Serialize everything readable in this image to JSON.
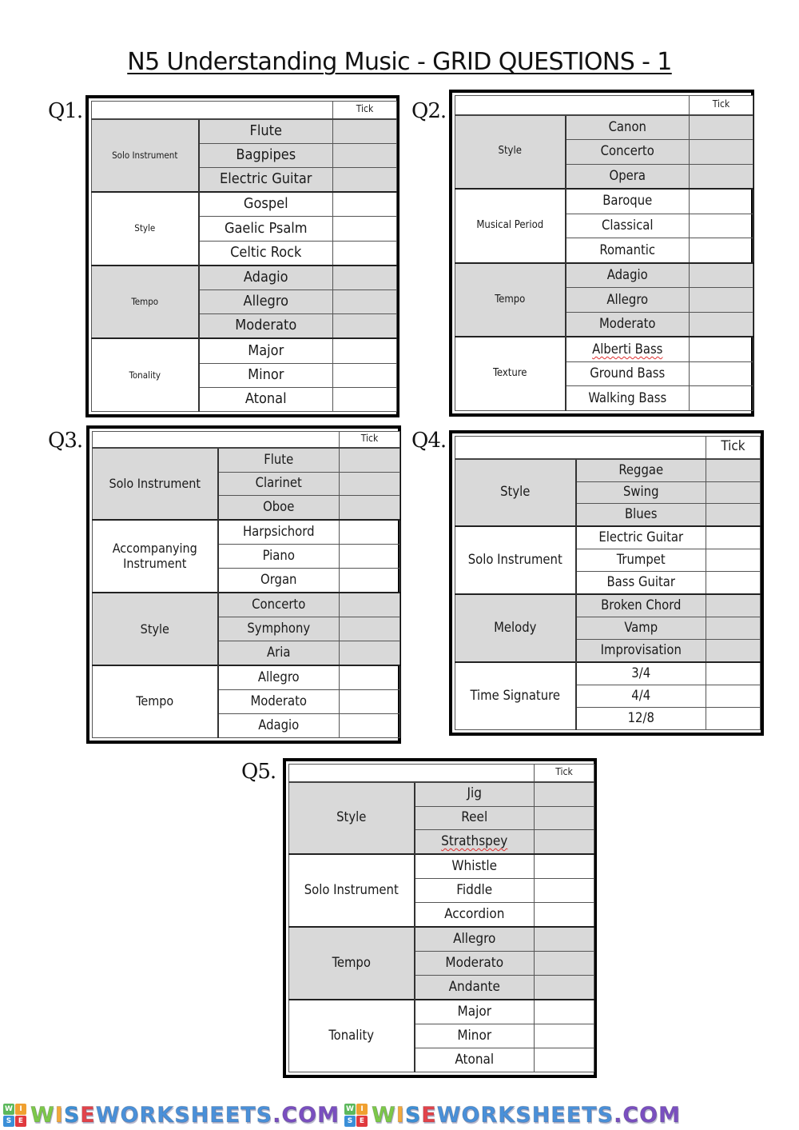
{
  "title": "N5 Understanding Music - GRID QUESTIONS - 1",
  "tick_header": "Tick",
  "questions": [
    {
      "label": "Q1.",
      "groups": [
        {
          "category": "Solo Instrument",
          "shaded": true,
          "options": [
            "Flute",
            "Bagpipes",
            "Electric Guitar"
          ]
        },
        {
          "category": "Style",
          "shaded": false,
          "options": [
            "Gospel",
            "Gaelic Psalm",
            "Celtic Rock"
          ]
        },
        {
          "category": "Tempo",
          "shaded": true,
          "options": [
            "Adagio",
            "Allegro",
            "Moderato"
          ]
        },
        {
          "category": "Tonality",
          "shaded": false,
          "options": [
            "Major",
            "Minor",
            "Atonal"
          ]
        }
      ]
    },
    {
      "label": "Q2.",
      "groups": [
        {
          "category": "Style",
          "shaded": true,
          "options": [
            "Canon",
            "Concerto",
            "Opera"
          ]
        },
        {
          "category": "Musical Period",
          "shaded": false,
          "options": [
            "Baroque",
            "Classical",
            "Romantic"
          ]
        },
        {
          "category": "Tempo",
          "shaded": true,
          "options": [
            "Adagio",
            "Allegro",
            "Moderato"
          ]
        },
        {
          "category": "Texture",
          "shaded": false,
          "options": [
            "Alberti Bass",
            "Ground Bass",
            "Walking Bass"
          ]
        }
      ]
    },
    {
      "label": "Q3.",
      "groups": [
        {
          "category": "Solo Instrument",
          "shaded": true,
          "options": [
            "Flute",
            "Clarinet",
            "Oboe"
          ]
        },
        {
          "category": "Accompanying Instrument",
          "shaded": false,
          "options": [
            "Harpsichord",
            "Piano",
            "Organ"
          ]
        },
        {
          "category": "Style",
          "shaded": true,
          "options": [
            "Concerto",
            "Symphony",
            "Aria"
          ]
        },
        {
          "category": "Tempo",
          "shaded": false,
          "options": [
            "Allegro",
            "Moderato",
            "Adagio"
          ]
        }
      ]
    },
    {
      "label": "Q4.",
      "groups": [
        {
          "category": "Style",
          "shaded": true,
          "options": [
            "Reggae",
            "Swing",
            "Blues"
          ]
        },
        {
          "category": "Solo Instrument",
          "shaded": false,
          "options": [
            "Electric Guitar",
            "Trumpet",
            "Bass Guitar"
          ]
        },
        {
          "category": "Melody",
          "shaded": true,
          "options": [
            "Broken Chord",
            "Vamp",
            "Improvisation"
          ]
        },
        {
          "category": "Time Signature",
          "shaded": false,
          "options": [
            "3/4",
            "4/4",
            "12/8"
          ]
        }
      ]
    },
    {
      "label": "Q5.",
      "groups": [
        {
          "category": "Style",
          "shaded": true,
          "options": [
            "Jig",
            "Reel",
            "Strathspey"
          ]
        },
        {
          "category": "Solo Instrument",
          "shaded": false,
          "options": [
            "Whistle",
            "Fiddle",
            "Accordion"
          ]
        },
        {
          "category": "Tempo",
          "shaded": true,
          "options": [
            "Allegro",
            "Moderato",
            "Andante"
          ]
        },
        {
          "category": "Tonality",
          "shaded": false,
          "options": [
            "Major",
            "Minor",
            "Atonal"
          ]
        }
      ]
    }
  ],
  "footer": {
    "brand_text": "WISEWORKSHEETS.COM",
    "logo_letters": [
      "W",
      "I",
      "S",
      "E"
    ],
    "logo_colors": [
      "#5cb85c",
      "#f0a030",
      "#3a8fd8",
      "#e0393e"
    ],
    "letter_colors": [
      "#7cc84a",
      "#f3a93b",
      "#3d8fd6",
      "#e2434b",
      "#4a90d9",
      "#4a90d9",
      "#4a90d9",
      "#4a90d9",
      "#4a90d9",
      "#4a90d9",
      "#4a90d9",
      "#4a90d9",
      "#4a90d9",
      "#4a90d9",
      "#7a4fc0",
      "#7a4fc0",
      "#7a4fc0",
      "#7a4fc0"
    ]
  }
}
